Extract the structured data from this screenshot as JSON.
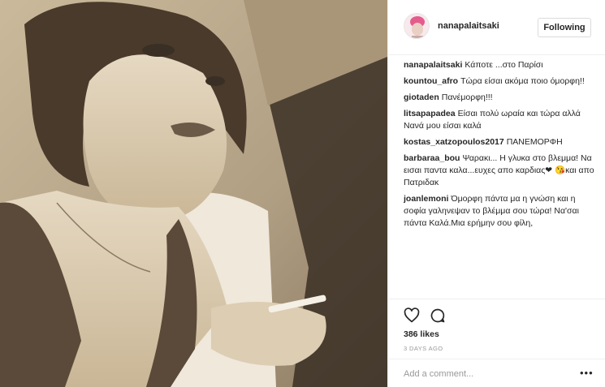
{
  "post": {
    "photo_alt": "",
    "username": "nanapalaitsaki",
    "follow_label": "Following",
    "likes": "386 likes",
    "date": "3 DAYS AGO",
    "add_comment_placeholder": "Add a comment...",
    "more_glyph": "•••"
  },
  "comments": [
    {
      "user": "nanapalaitsaki",
      "text": "Κάποτε ...στο Παρίσι"
    },
    {
      "user": "kountou_afro",
      "text": "Τώρα είσαι ακόμα ποιο όμορφη!!"
    },
    {
      "user": "giotaden",
      "text": "Πανέμορφη!!!"
    },
    {
      "user": "litsapapadea",
      "text": "Είσαι πολύ ωραία και τώρα αλλά Νανά μου είσαι καλά"
    },
    {
      "user": "kostas_xatzopoulos2017",
      "text": "ΠΑΝΕΜΟΡΦΗ"
    },
    {
      "user": "barbaraa_bou",
      "text": "Ψαρακι... Η γλυκα στο βλεμμα! Να εισαι παντα καλα...ευχες απο καρδιας❤ 😘και απο Πατριδακ"
    },
    {
      "user": "joanlemoni",
      "text": "Όμορφη πάντα μα η γνώση και η σοφία γαληνεψαν το βλέμμα σου τώρα! Να'σαι πάντα Καλά.Μια ερήμην σου φίλη,"
    }
  ],
  "icons": {
    "like": "heart-outline-icon",
    "comment": "speech-bubble-icon",
    "more": "ellipsis-icon"
  },
  "colors": {
    "text": "#262626",
    "muted": "#999999",
    "border": "#efefef",
    "sepia_light": "#d8c9ad",
    "sepia_dark": "#3a2f24"
  }
}
